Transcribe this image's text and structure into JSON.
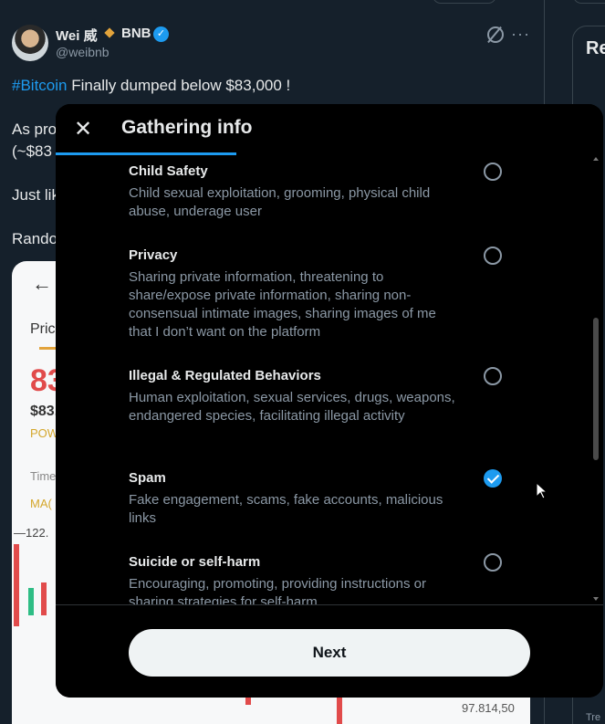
{
  "tweet": {
    "author_name": "Wei 威",
    "author_brand": "BNB",
    "verified_glyph": "✓",
    "handle": "@weibnb",
    "hashtag": "#Bitcoin",
    "line1_rest": " Finally dumped below $83,000 !",
    "line2_partial": "As pro",
    "line3_partial": "(~$83",
    "line4_partial": "Just lik",
    "line5_partial": "Rando",
    "more_glyph": "···"
  },
  "card": {
    "back_glyph": "←",
    "tab_partial": "Pric",
    "price_partial": "83",
    "price_small_partial": "$83.",
    "pow_partial": "POW",
    "time_partial": "Time",
    "ma_partial": "MA(",
    "axis_partial": "—122.",
    "axis_low": "97.814,50"
  },
  "right_column": {
    "title_partial": "Re",
    "footer_partial": "Tre"
  },
  "modal": {
    "close_glyph": "✕",
    "title": "Gathering info",
    "progress_fraction": 0.33,
    "options": [
      {
        "title": "Child Safety",
        "description": "Child sexual exploitation, grooming, physical child abuse, underage user",
        "checked": false
      },
      {
        "title": "Privacy",
        "description": "Sharing private information, threatening to share/expose private information, sharing non-consensual intimate images, sharing images of me that I don’t want on the platform",
        "checked": false
      },
      {
        "title": "Illegal & Regulated Behaviors",
        "description": "Human exploitation, sexual services, drugs, weapons, endangered species, facilitating illegal activity",
        "checked": false
      },
      {
        "title": "Spam",
        "description": "Fake engagement, scams, fake accounts, malicious links",
        "checked": true
      },
      {
        "title": "Suicide or self-harm",
        "description": "Encouraging, promoting, providing instructions or sharing strategies for self-harm.",
        "checked": false
      }
    ],
    "next_label": "Next"
  },
  "colors": {
    "accent": "#1d9bf0",
    "background": "#15202b",
    "modal": "#000000",
    "muted_text": "#8b98a5",
    "price_red": "#e14b4b"
  },
  "icons": [
    "close-icon",
    "verified-icon",
    "grok-icon",
    "more-icon",
    "back-arrow-icon",
    "checkmark-icon"
  ]
}
